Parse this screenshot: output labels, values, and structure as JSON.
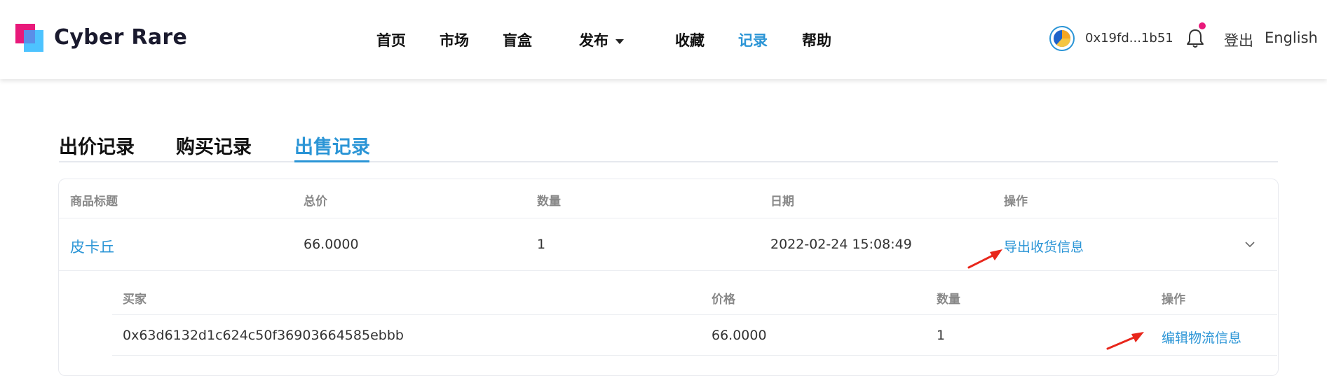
{
  "brand": {
    "name": "Cyber Rare"
  },
  "nav": [
    {
      "label": "首页"
    },
    {
      "label": "市场"
    },
    {
      "label": "盲盒"
    },
    {
      "label": "发布"
    },
    {
      "label": "收藏"
    },
    {
      "label": "记录",
      "active": true
    },
    {
      "label": "帮助"
    }
  ],
  "account": {
    "address": "0x19fd...1b51",
    "login": "登出",
    "language": "English"
  },
  "tabs": [
    {
      "label": "出价记录"
    },
    {
      "label": "购买记录"
    },
    {
      "label": "出售记录",
      "active": true
    }
  ],
  "table": {
    "headers": [
      "商品标题",
      "总价",
      "数量",
      "日期",
      "操作"
    ],
    "rows": [
      {
        "title": "皮卡丘",
        "total": "66.0000",
        "quantity": "1",
        "date": "2022-02-24 15:08:49",
        "action": "导出收货信息"
      }
    ]
  },
  "detail": {
    "headers": [
      "买家",
      "价格",
      "数量",
      "操作"
    ],
    "rows": [
      {
        "buyer": "0x63d6132d1c624c50f36903664585ebbb",
        "price": "66.0000",
        "quantity": "1",
        "action": "编辑物流信息"
      }
    ]
  },
  "colors": {
    "accent": "#2b95d6",
    "annotation_arrow": "#e8261b",
    "notification_dot": "#e8197a"
  }
}
